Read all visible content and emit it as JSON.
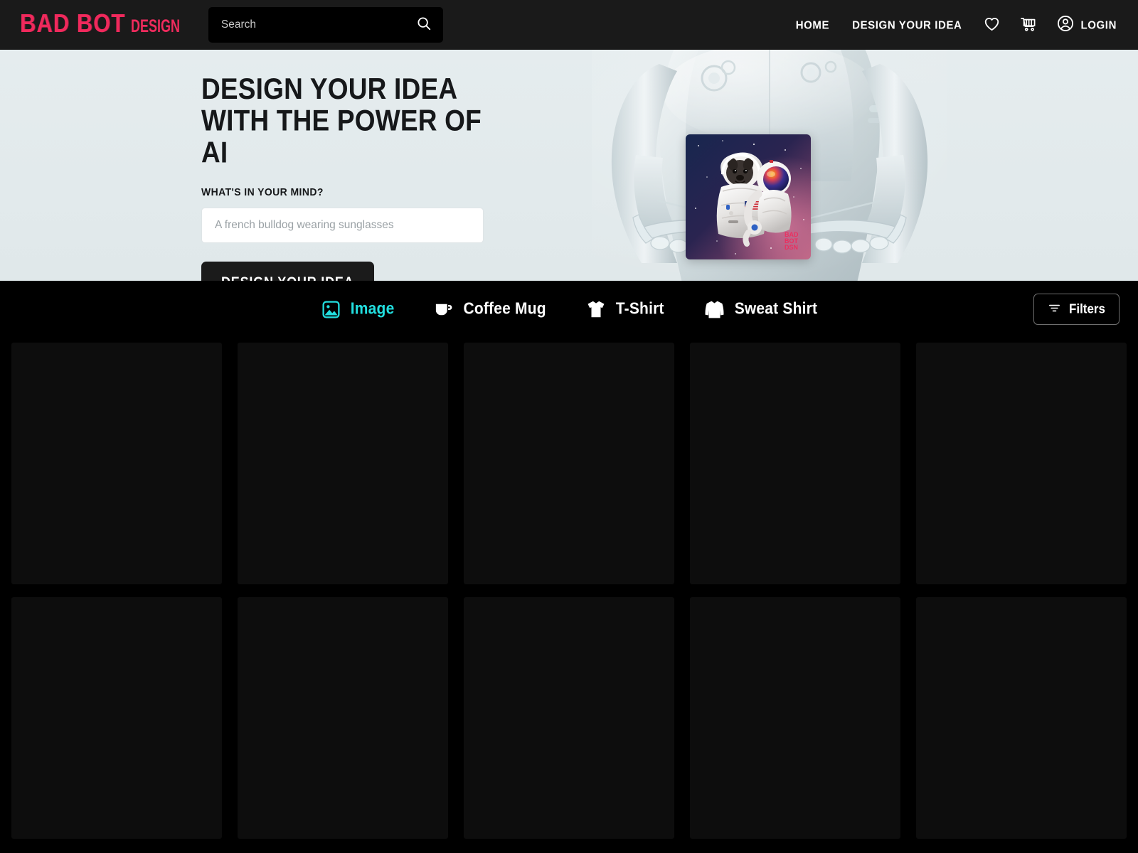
{
  "brand": {
    "logo_main": "BAD BOT",
    "logo_sub": "DESIGN",
    "logo_color": "#f0295c"
  },
  "header": {
    "search": {
      "placeholder": "Search",
      "value": "",
      "icon": "search-icon"
    },
    "nav": [
      {
        "label": "HOME",
        "name": "nav-home"
      },
      {
        "label": "DESIGN YOUR IDEA",
        "name": "nav-design-your-idea"
      }
    ],
    "icons": [
      {
        "name": "heart-icon",
        "label": "Wishlist"
      },
      {
        "name": "cart-icon",
        "label": "Cart"
      }
    ],
    "login": {
      "label": "LOGIN",
      "icon": "account-circle-icon"
    }
  },
  "hero": {
    "title": "DESIGN YOUR IDEA WITH THE POWER OF AI",
    "sublabel": "WHAT'S IN YOUR MIND?",
    "input_placeholder": "A french bulldog wearing sunglasses",
    "input_value": "",
    "cta_label": "DESIGN YOUR IDEA",
    "background_color": "#e3ebed",
    "artwork": {
      "name": "robot-holding-image",
      "thumbnail_name": "pug-astronaut-artwork",
      "watermark": "BAD BOT DESIGN"
    }
  },
  "categories": {
    "active": "Image",
    "accent_color": "#22dfe0",
    "items": [
      {
        "label": "Image",
        "icon": "image-icon",
        "active": true
      },
      {
        "label": "Coffee Mug",
        "icon": "coffee-mug-icon",
        "active": false
      },
      {
        "label": "T-Shirt",
        "icon": "tshirt-icon",
        "active": false
      },
      {
        "label": "Sweat Shirt",
        "icon": "sweatshirt-icon",
        "active": false
      }
    ],
    "filters": {
      "label": "Filters",
      "icon": "filter-icon"
    }
  },
  "grid": {
    "columns": 5,
    "placeholder_color": "#0d0d0d",
    "rows": [
      [
        {
          "name": "result-card"
        },
        {
          "name": "result-card"
        },
        {
          "name": "result-card"
        },
        {
          "name": "result-card"
        },
        {
          "name": "result-card"
        }
      ],
      [
        {
          "name": "result-card"
        },
        {
          "name": "result-card"
        },
        {
          "name": "result-card"
        },
        {
          "name": "result-card"
        },
        {
          "name": "result-card"
        }
      ]
    ]
  }
}
